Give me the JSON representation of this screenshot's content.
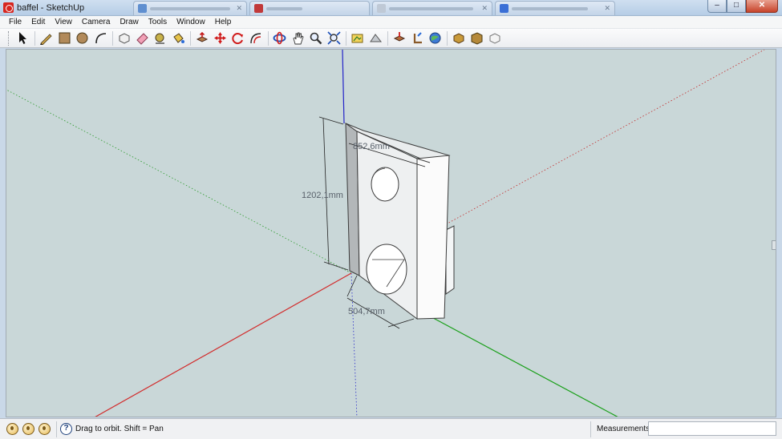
{
  "window": {
    "title": "baffel - SketchUp",
    "controls": [
      "minimize",
      "maximize",
      "close"
    ]
  },
  "menu": [
    "File",
    "Edit",
    "View",
    "Camera",
    "Draw",
    "Tools",
    "Window",
    "Help"
  ],
  "toolbar": [
    {
      "name": "select-tool"
    },
    {
      "sep": true
    },
    {
      "name": "line-tool"
    },
    {
      "name": "rectangle-tool"
    },
    {
      "name": "circle-tool"
    },
    {
      "name": "arc-tool"
    },
    {
      "sep": true
    },
    {
      "name": "make-component-tool"
    },
    {
      "name": "eraser-tool"
    },
    {
      "name": "tape-measure-tool"
    },
    {
      "name": "paint-bucket-tool"
    },
    {
      "sep": true
    },
    {
      "name": "push-pull-tool"
    },
    {
      "name": "move-tool"
    },
    {
      "name": "rotate-tool"
    },
    {
      "name": "offset-tool"
    },
    {
      "sep": true
    },
    {
      "name": "orbit-tool"
    },
    {
      "name": "pan-tool"
    },
    {
      "name": "zoom-tool"
    },
    {
      "name": "zoom-extents-tool"
    },
    {
      "sep": true
    },
    {
      "name": "add-location-tool"
    },
    {
      "name": "toggle-terrain-tool"
    },
    {
      "name": "photo-textures-tool"
    },
    {
      "name": "get-models-tool"
    },
    {
      "name": "share-model-tool"
    },
    {
      "sep": true
    },
    {
      "name": "components-tool"
    },
    {
      "name": "extension-warehouse-tool"
    },
    {
      "name": "styles-tool"
    }
  ],
  "dimensions": {
    "width_label": "852,6mm",
    "height_label": "1202,1mm",
    "depth_label": "504,7mm"
  },
  "status": {
    "hint": "Drag to orbit.  Shift = Pan",
    "measurements_label": "Measurements",
    "measurements_value": ""
  },
  "colors": {
    "viewport_bg": "#c9d7d8",
    "axis_red": "#d22b2b",
    "axis_green": "#1aa01a",
    "axis_blue": "#2323c8",
    "model_face": "#ffffff",
    "model_edge": "#3b3b3b"
  }
}
